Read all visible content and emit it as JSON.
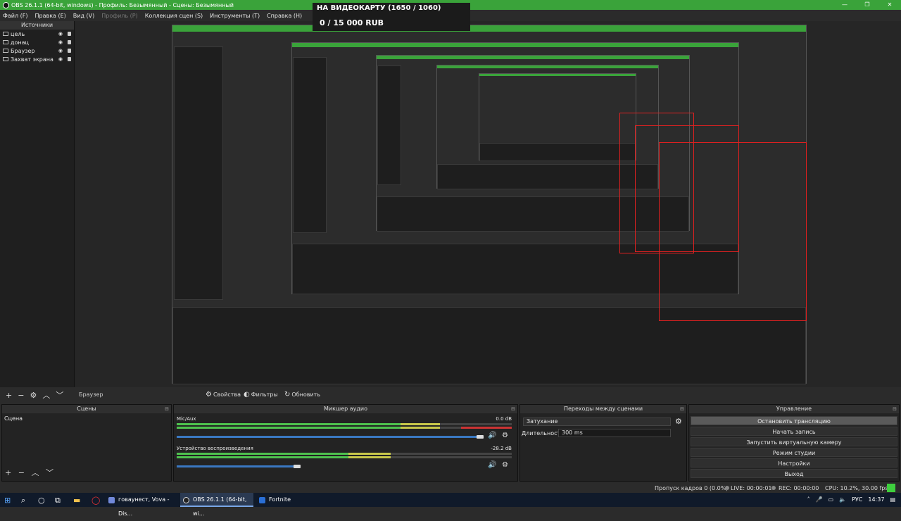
{
  "window": {
    "title": "OBS 26.1.1 (64-bit, windows) - Профиль: Безымянный - Сцены: Безымянный",
    "controls": [
      "—",
      "❐",
      "✕"
    ]
  },
  "menu": [
    {
      "label": "Файл (F)",
      "disabled": false
    },
    {
      "label": "Правка (E)",
      "disabled": false
    },
    {
      "label": "Вид (V)",
      "disabled": false
    },
    {
      "label": "Профиль (P)",
      "disabled": true
    },
    {
      "label": "Коллекция сцен (S)",
      "disabled": false
    },
    {
      "label": "Инструменты (T)",
      "disabled": false
    },
    {
      "label": "Справка (H)",
      "disabled": false
    }
  ],
  "sources": {
    "header": "Источники",
    "items": [
      "цель",
      "донац",
      "Браузер",
      "Захват экрана"
    ]
  },
  "donation": {
    "title": "НА ВИДЕОКАРТУ (1650 / 1060)",
    "amount": "0 / 15 000 RUB"
  },
  "toolbar": {
    "selected_source": "Браузер",
    "properties": "Свойства",
    "filters": "Фильтры",
    "refresh": "Обновить"
  },
  "scenes": {
    "header": "Сцены",
    "items": [
      "Сцена"
    ]
  },
  "mixer": {
    "header": "Микшер аудио",
    "channels": [
      {
        "name": "Mic/Aux",
        "db": "0.0 dB",
        "level": 0.78,
        "volume": 0.93
      },
      {
        "name": "Устройство воспроизведения",
        "db": "-28.2 dB",
        "level": 0.63,
        "volume": 0.36
      }
    ]
  },
  "transitions": {
    "header": "Переходы между сценами",
    "selected": "Затухание",
    "duration_label": "Длительность",
    "duration_value": "300 ms"
  },
  "controls": {
    "header": "Управление",
    "buttons": [
      "Остановить трансляцию",
      "Начать запись",
      "Запустить виртуальную камеру",
      "Режим студии",
      "Настройки",
      "Выход"
    ]
  },
  "status": {
    "dropped": "Пропуск кадров 0 (0.0%)",
    "live": "LIVE: 00:00:01",
    "rec": "REC: 00:00:00",
    "cpu": "CPU: 10.2%, 30.00 fps"
  },
  "taskbar": {
    "apps": [
      "говаунест, Vova - Dis...",
      "OBS 26.1.1 (64-bit, wi...",
      "Fortnite"
    ],
    "lang": "РУС",
    "time": "14:37"
  },
  "colors": {
    "title_green": "#3aa33a",
    "red_outline": "#e02020",
    "meter_green": "#4ec24e",
    "meter_yellow": "#c8c84a",
    "meter_red": "#cc3333",
    "live_indicator": "#3ecf3e"
  }
}
